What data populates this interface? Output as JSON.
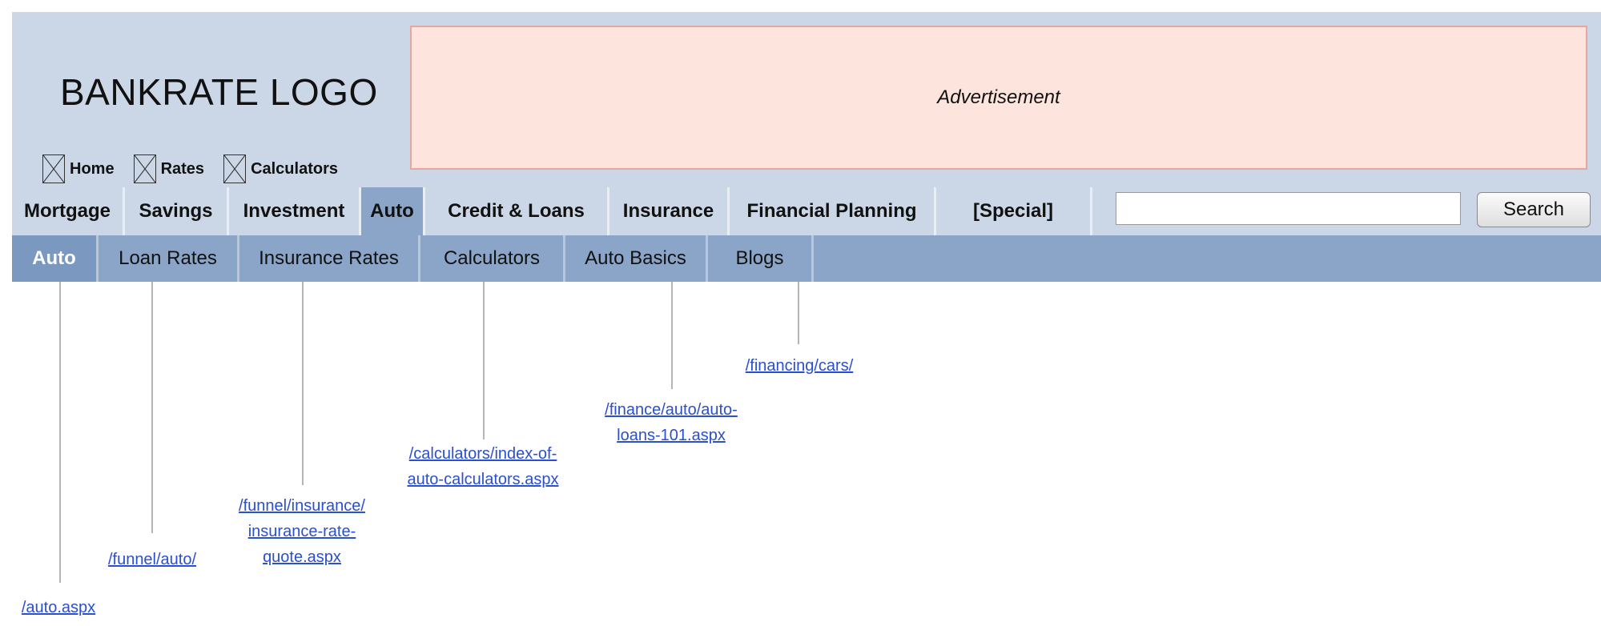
{
  "header": {
    "logo": "BANKRATE LOGO",
    "util_nav": [
      {
        "label": "Home",
        "icon": "broken-image-icon"
      },
      {
        "label": "Rates",
        "icon": "broken-image-icon"
      },
      {
        "label": "Calculators",
        "icon": "broken-image-icon"
      }
    ],
    "ad_label": "Advertisement"
  },
  "main_nav": {
    "items": [
      "Mortgage",
      "Savings",
      "Investment",
      "Auto",
      "Credit & Loans",
      "Insurance",
      "Financial Planning",
      "[Special]"
    ],
    "active": "Auto"
  },
  "search": {
    "value": "",
    "button_label": "Search"
  },
  "sub_nav": {
    "items": [
      "Auto",
      "Loan Rates",
      "Insurance Rates",
      "Calculators",
      "Auto Basics",
      "Blogs"
    ],
    "active": "Auto"
  },
  "annotations": [
    {
      "target": "Auto",
      "lines": [
        "/auto.aspx"
      ]
    },
    {
      "target": "Loan Rates",
      "lines": [
        "/funnel/auto/"
      ]
    },
    {
      "target": "Insurance Rates",
      "lines": [
        "/funnel/insurance/",
        "insurance-rate-",
        "quote.aspx"
      ]
    },
    {
      "target": "Calculators",
      "lines": [
        "/calculators/index-of-",
        "auto-calculators.aspx"
      ]
    },
    {
      "target": "Auto Basics",
      "lines": [
        "/finance/auto/auto-",
        "loans-101.aspx"
      ]
    },
    {
      "target": "Blogs",
      "lines": [
        "/financing/cars/"
      ]
    }
  ],
  "colors": {
    "header_bg": "#cbd7e6",
    "subnav_bg": "#8aa5c8",
    "active_main": "#8aa5c8",
    "active_sub": "#7b98c0",
    "ad_bg": "#fde4dd",
    "link": "#2a4fd0"
  }
}
